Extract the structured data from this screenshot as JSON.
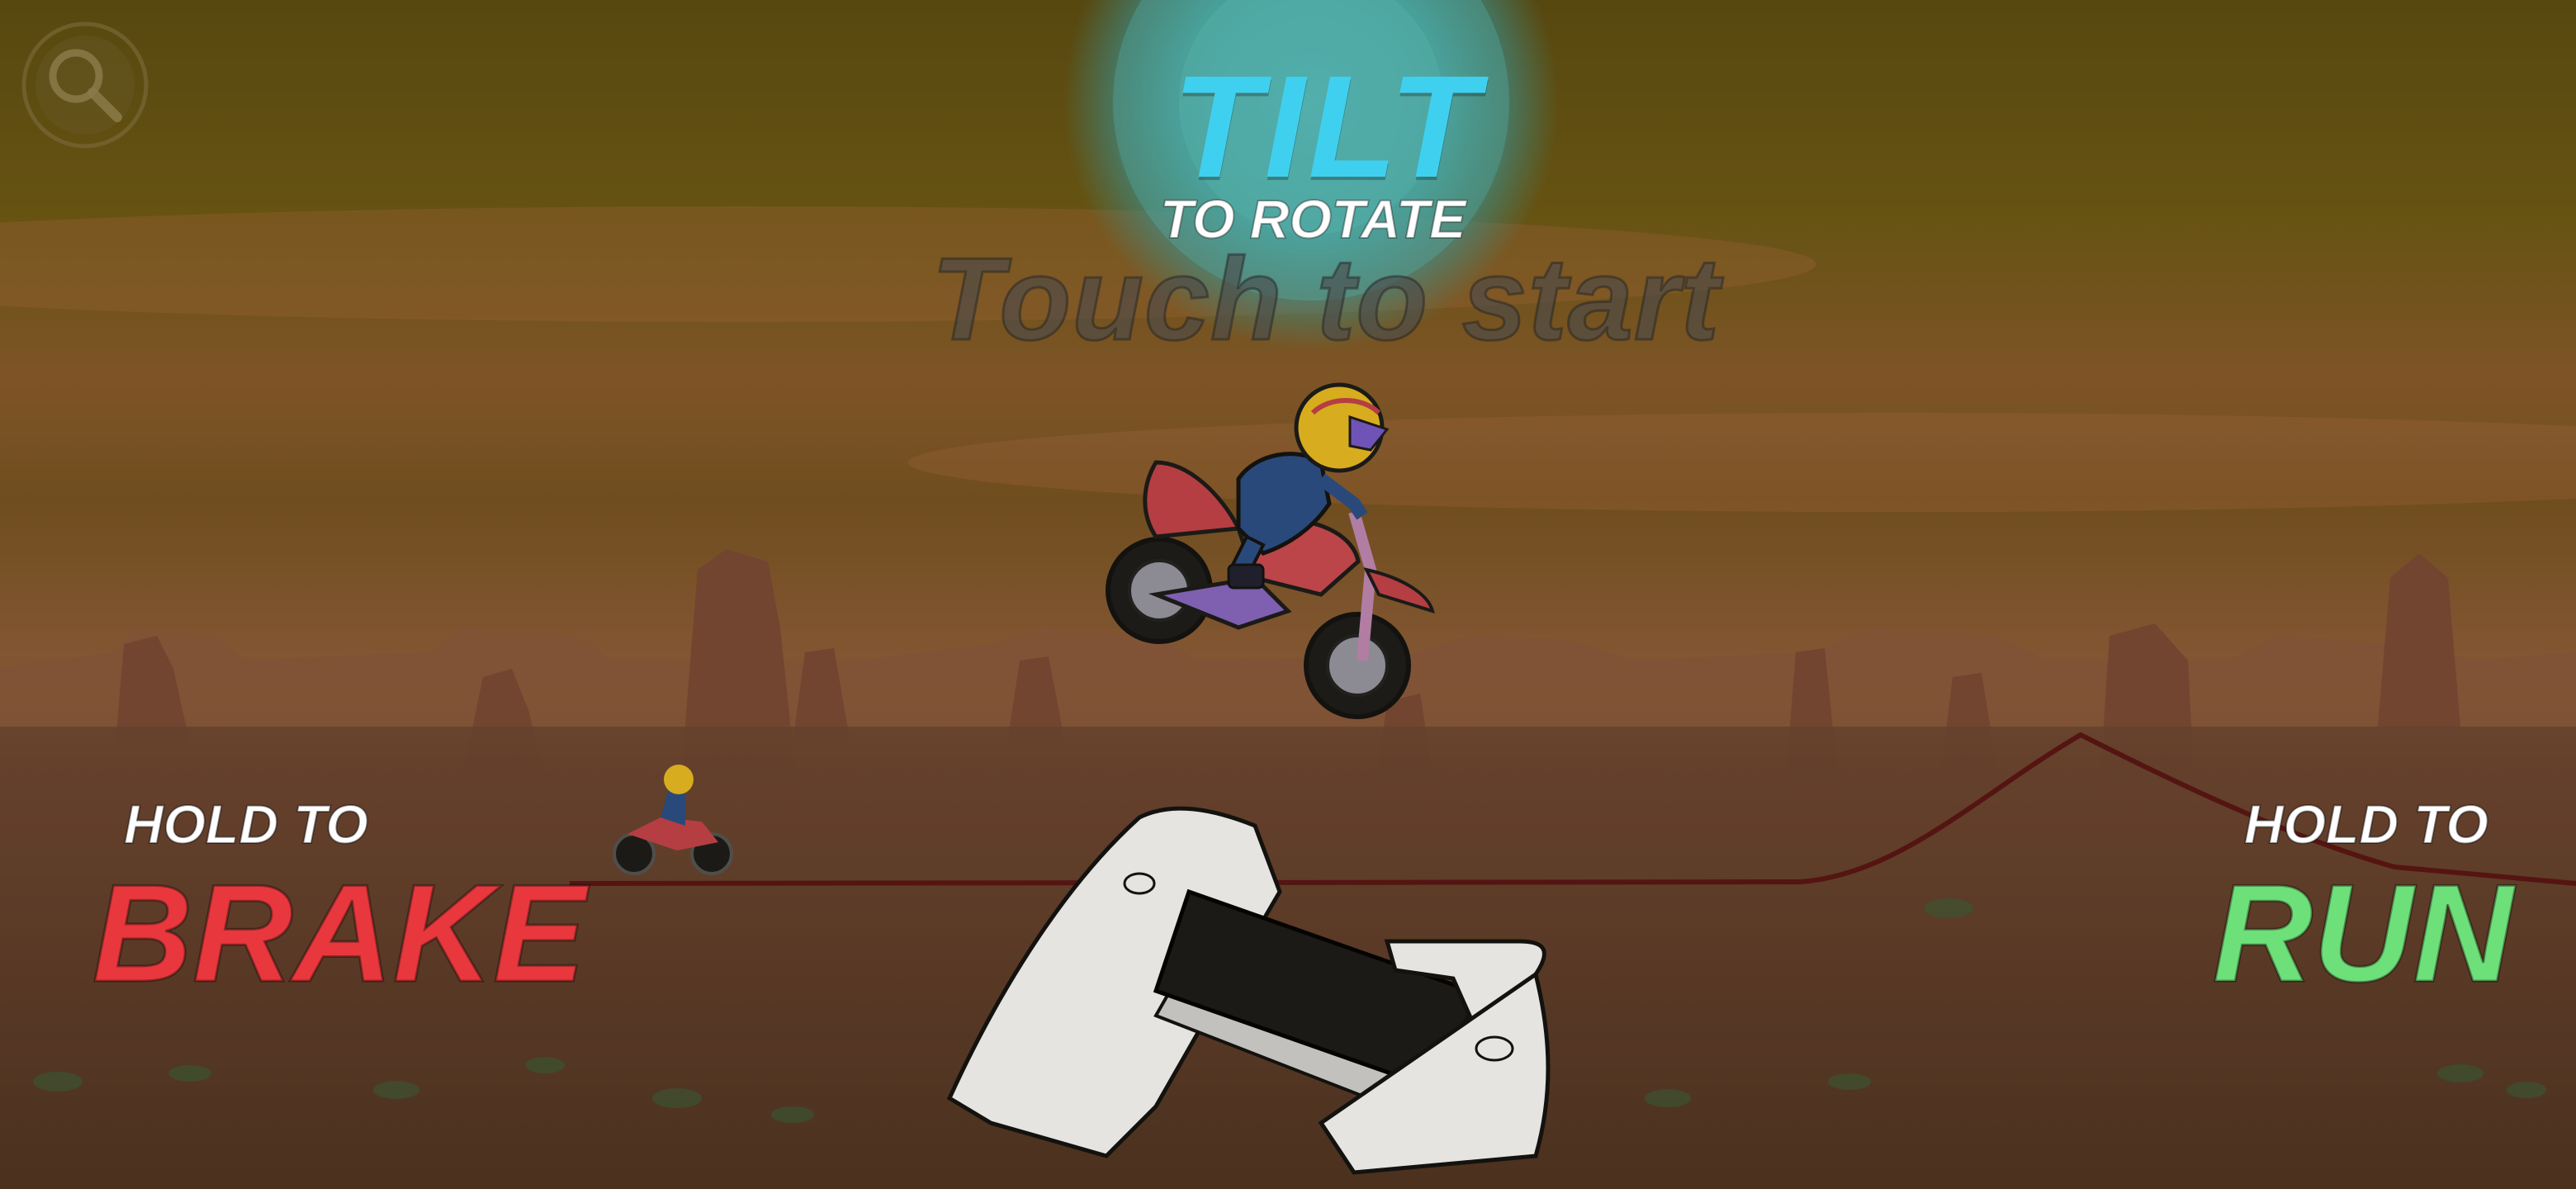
{
  "hud": {
    "tilt_title": "TILT",
    "tilt_subtitle": "TO ROTATE",
    "touch_to_start": "Touch to start",
    "brake_hint": "HOLD TO",
    "brake_label": "BRAKE",
    "run_hint": "HOLD TO",
    "run_label": "RUN"
  },
  "icons": {
    "zoom": "magnifier-icon",
    "phone_hands": "tilt-phone-hands-icon"
  },
  "colors": {
    "sky_top": "#6b5a12",
    "sky_band": "#8a5a2e",
    "ground": "#5b3c26",
    "tilt_accent": "#3fd0f0",
    "brake_accent": "#e8383d",
    "run_accent": "#6ee07a",
    "track_line": "#5a1414",
    "bike_body": "#cc4a50",
    "rider_suit": "#2a4f8a",
    "helmet": "#f0c022"
  }
}
